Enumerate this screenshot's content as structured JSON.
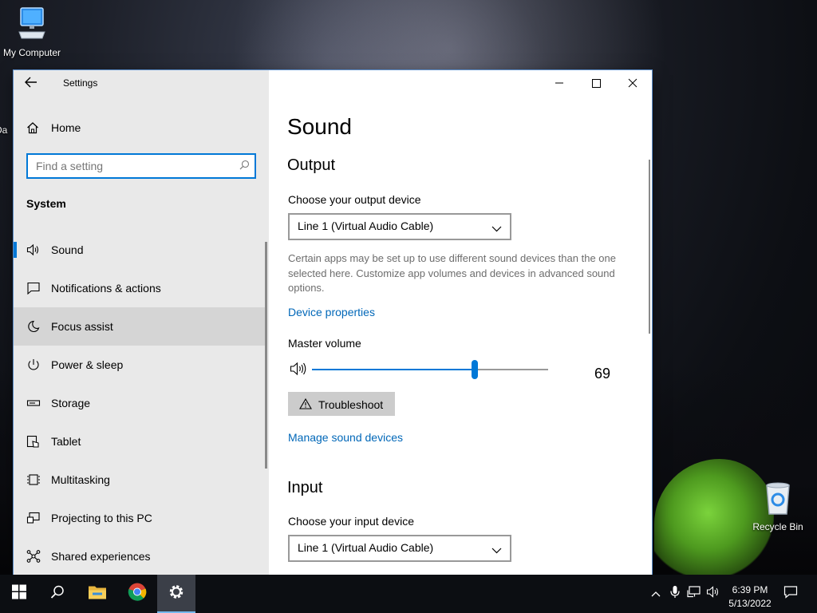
{
  "desktop": {
    "icons": [
      {
        "label": "My Computer"
      },
      {
        "label": "Recycle Bin"
      }
    ],
    "partial_label": "Da"
  },
  "window": {
    "app_title": "Settings",
    "home_label": "Home",
    "search": {
      "placeholder": "Find a setting"
    },
    "section_label": "System",
    "nav_items": [
      {
        "label": "Sound",
        "icon": "speaker-icon"
      },
      {
        "label": "Notifications & actions",
        "icon": "notification-icon"
      },
      {
        "label": "Focus assist",
        "icon": "moon-icon"
      },
      {
        "label": "Power & sleep",
        "icon": "power-icon"
      },
      {
        "label": "Storage",
        "icon": "storage-icon"
      },
      {
        "label": "Tablet",
        "icon": "tablet-icon"
      },
      {
        "label": "Multitasking",
        "icon": "multitasking-icon"
      },
      {
        "label": "Projecting to this PC",
        "icon": "projecting-icon"
      },
      {
        "label": "Shared experiences",
        "icon": "shared-icon"
      }
    ],
    "selected_nav": "Sound",
    "hovered_nav": "Focus assist"
  },
  "content": {
    "title": "Sound",
    "output": {
      "heading": "Output",
      "device_label": "Choose your output device",
      "device_value": "Line 1 (Virtual Audio Cable)",
      "description": "Certain apps may be set up to use different sound devices than the one selected here. Customize app volumes and devices in advanced sound options.",
      "device_properties_link": "Device properties",
      "master_volume_label": "Master volume",
      "master_volume_value": "69",
      "troubleshoot_label": "Troubleshoot",
      "manage_devices_link": "Manage sound devices"
    },
    "input": {
      "heading": "Input",
      "device_label": "Choose your input device",
      "device_value": "Line 1 (Virtual Audio Cable)"
    }
  },
  "taskbar": {
    "time": "6:39 PM",
    "date": "5/13/2022"
  },
  "colors": {
    "accent": "#0078d7",
    "link": "#0067b8"
  }
}
